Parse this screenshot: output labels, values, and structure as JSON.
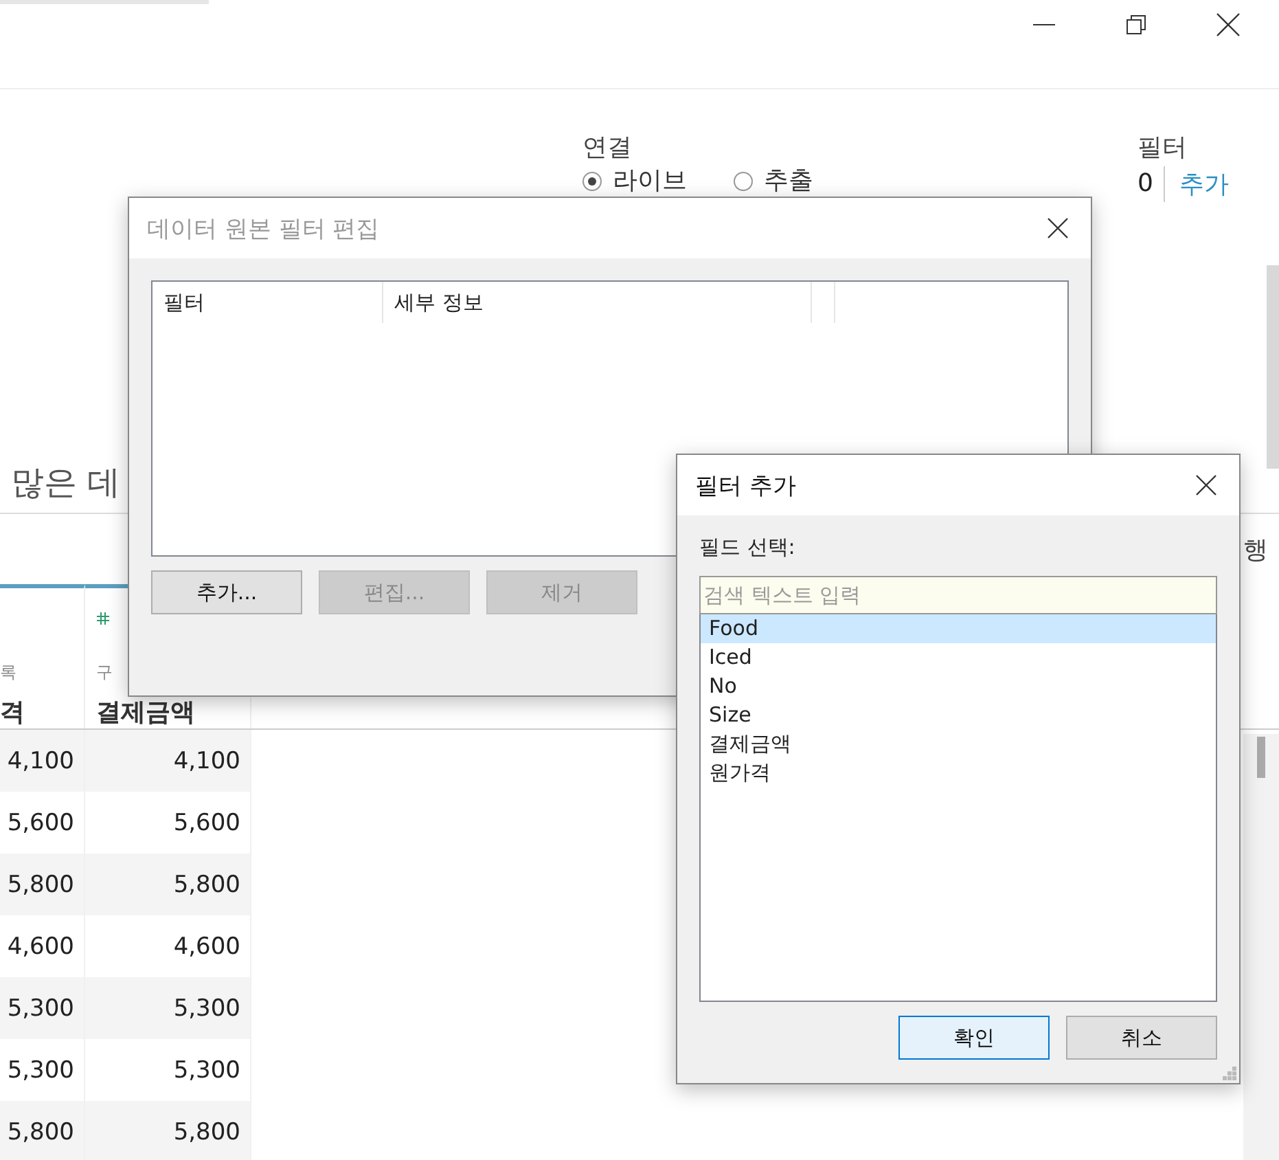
{
  "connection": {
    "label": "연결",
    "options": [
      {
        "label": "라이브",
        "selected": true
      },
      {
        "label": "추출",
        "selected": false
      }
    ]
  },
  "filters": {
    "label": "필터",
    "count": "0",
    "add_link": "추가"
  },
  "heading": "많은 데",
  "toolbar": {
    "label": "행"
  },
  "table": {
    "columns": [
      {
        "kind": "plain",
        "type_label": "록",
        "name": "격"
      },
      {
        "kind": "number",
        "type_label": "구",
        "name": "결제금액"
      }
    ],
    "rows": [
      [
        "4,100",
        "4,100"
      ],
      [
        "5,600",
        "5,600"
      ],
      [
        "5,800",
        "5,800"
      ],
      [
        "4,600",
        "4,600"
      ],
      [
        "5,300",
        "5,300"
      ],
      [
        "5,300",
        "5,300"
      ],
      [
        "5,800",
        "5,800"
      ]
    ]
  },
  "edit_dialog": {
    "title": "데이터 원본 필터 편집",
    "active": false,
    "columns": [
      "필터",
      "세부 정보"
    ],
    "buttons": [
      {
        "label": "추가...",
        "disabled": false
      },
      {
        "label": "편집...",
        "disabled": true
      },
      {
        "label": "제거",
        "disabled": true
      }
    ]
  },
  "add_dialog": {
    "title": "필터 추가",
    "active": true,
    "field_label": "필드 선택:",
    "search": {
      "placeholder": "검색 텍스트 입력"
    },
    "fields": [
      {
        "label": "Food",
        "selected": true
      },
      {
        "label": "Iced",
        "selected": false
      },
      {
        "label": "No",
        "selected": false
      },
      {
        "label": "Size",
        "selected": false
      },
      {
        "label": "결제금액",
        "selected": false
      },
      {
        "label": "원가격",
        "selected": false
      }
    ],
    "buttons": [
      {
        "label": "확인",
        "default": true
      },
      {
        "label": "취소",
        "default": false
      }
    ]
  }
}
